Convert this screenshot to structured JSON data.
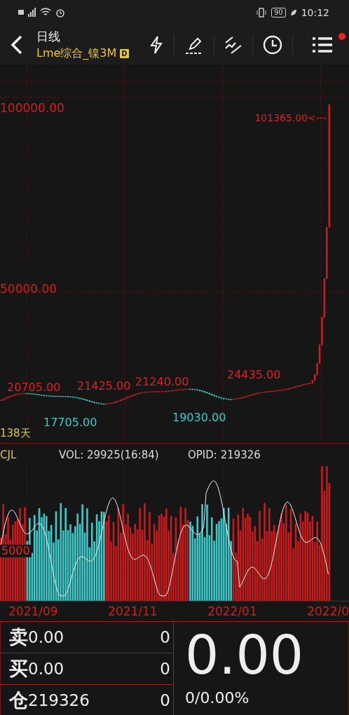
{
  "status_bar": {
    "time": "10:12",
    "battery": "90"
  },
  "header": {
    "period": "日线",
    "symbol": "Lme综合_镍3M",
    "badge": "D",
    "menu_badge": true
  },
  "price_chart": {
    "y_labels": [
      "100000.00",
      "50000.00"
    ],
    "high_label": "101365.00<---",
    "days": "138天",
    "annotations": [
      {
        "text": "20705.00",
        "kind": "high"
      },
      {
        "text": "21425.00",
        "kind": "high"
      },
      {
        "text": "21240.00",
        "kind": "high"
      },
      {
        "text": "24435.00",
        "kind": "high"
      },
      {
        "text": "17705.00",
        "kind": "low"
      },
      {
        "text": "19030.00",
        "kind": "low"
      }
    ]
  },
  "volume_chart": {
    "name": "CJL",
    "vol": "VOL: 29925(16:84)",
    "opid": "OPID: 219326",
    "axis_label": "5000"
  },
  "dates": [
    "2021/09",
    "2021/11",
    "2022/01",
    "2022/0"
  ],
  "quote": {
    "rows": [
      {
        "label": "卖",
        "price": "0.00",
        "qty": "0"
      },
      {
        "label": "买",
        "price": "0.00",
        "qty": "0"
      },
      {
        "label": "仓",
        "price": "219326",
        "qty": "0"
      }
    ],
    "last": "0.00",
    "change": "0/0.00%"
  }
}
